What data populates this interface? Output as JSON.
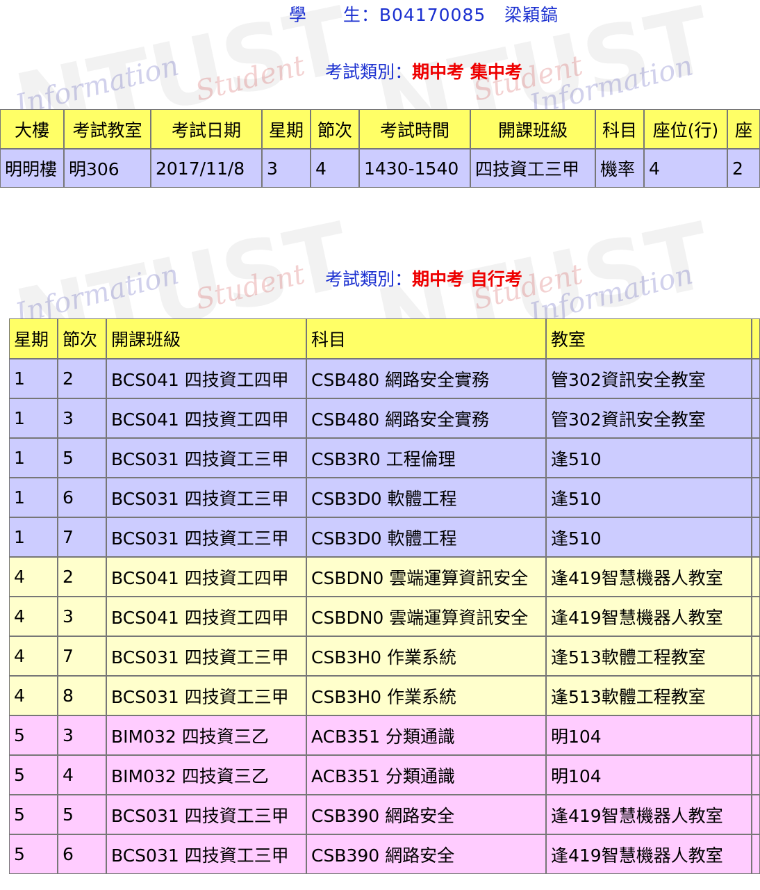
{
  "student": {
    "label": "學　　生：",
    "id": "B04170085",
    "name": "梁穎鎬"
  },
  "exam1": {
    "category_label": "考試類別：",
    "category_value": "期中考 集中考",
    "headers": [
      "大樓",
      "考試教室",
      "考試日期",
      "星期",
      "節次",
      "考試時間",
      "開課班級",
      "科目",
      "座位(行)",
      "座"
    ],
    "rows": [
      [
        "明明樓",
        "明306",
        "2017/11/8",
        "3",
        "4",
        "1430-1540",
        "四技資工三甲",
        "機率",
        "4",
        "2"
      ]
    ]
  },
  "exam2": {
    "category_label": "考試類別：",
    "category_value": "期中考 自行考",
    "headers": [
      "星期",
      "節次",
      "開課班級",
      "科目",
      "教室",
      ""
    ],
    "rows": [
      [
        "1",
        "2",
        "BCS041 四技資工四甲",
        "CSB480 網路安全實務",
        "管302資訊安全教室"
      ],
      [
        "1",
        "3",
        "BCS041 四技資工四甲",
        "CSB480 網路安全實務",
        "管302資訊安全教室"
      ],
      [
        "1",
        "5",
        "BCS031 四技資工三甲",
        "CSB3R0 工程倫理",
        "逢510"
      ],
      [
        "1",
        "6",
        "BCS031 四技資工三甲",
        "CSB3D0 軟體工程",
        "逢510"
      ],
      [
        "1",
        "7",
        "BCS031 四技資工三甲",
        "CSB3D0 軟體工程",
        "逢510"
      ],
      [
        "4",
        "2",
        "BCS041 四技資工四甲",
        "CSBDN0 雲端運算資訊安全",
        "逢419智慧機器人教室"
      ],
      [
        "4",
        "3",
        "BCS041 四技資工四甲",
        "CSBDN0 雲端運算資訊安全",
        "逢419智慧機器人教室"
      ],
      [
        "4",
        "7",
        "BCS031 四技資工三甲",
        "CSB3H0 作業系統",
        "逢513軟體工程教室"
      ],
      [
        "4",
        "8",
        "BCS031 四技資工三甲",
        "CSB3H0 作業系統",
        "逢513軟體工程教室"
      ],
      [
        "5",
        "3",
        "BIM032 四技資三乙",
        "ACB351 分類通識",
        "明104"
      ],
      [
        "5",
        "4",
        "BIM032 四技資三乙",
        "ACB351 分類通識",
        "明104"
      ],
      [
        "5",
        "5",
        "BCS031 四技資工三甲",
        "CSB390 網路安全",
        "逢419智慧機器人教室"
      ],
      [
        "5",
        "6",
        "BCS031 四技資工三甲",
        "CSB390 網路安全",
        "逢419智慧機器人教室"
      ]
    ],
    "row_colors": [
      "blue",
      "blue",
      "blue",
      "blue",
      "blue",
      "yellow",
      "yellow",
      "yellow",
      "yellow",
      "pink",
      "pink",
      "pink",
      "pink"
    ]
  },
  "watermark": {
    "words": [
      "Student",
      "Information",
      "NTUST"
    ]
  }
}
